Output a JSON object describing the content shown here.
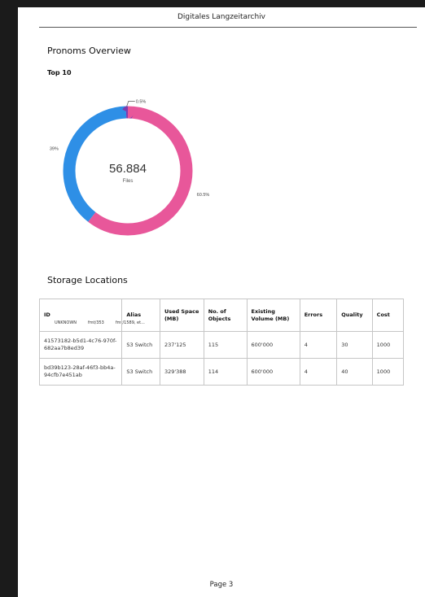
{
  "header": {
    "title": "Digitales Langzeitarchiv"
  },
  "pronoms": {
    "title": "Pronoms Overview",
    "subtitle": "Top 10"
  },
  "chart_data": {
    "type": "pie",
    "variant": "donut",
    "title": "Top 10",
    "center_value": "56.884",
    "center_label": "Files",
    "categories": [
      "UNKNOWN",
      "fmt/353",
      "fmt/1589, et..."
    ],
    "values": [
      39,
      60.5,
      0.5
    ],
    "slice_labels": [
      "39%",
      "60.5%",
      "0.5%"
    ],
    "colors": [
      "#2e8fe6",
      "#e8579a",
      "#7b3db0"
    ],
    "legend_position": "bottom-left"
  },
  "storage": {
    "title": "Storage Locations",
    "columns": [
      "ID",
      "Alias",
      "Used Space (MB)",
      "No. of Objects",
      "Existing Volume (MB)",
      "Errors",
      "Quality",
      "Cost"
    ],
    "rows": [
      [
        "41573182-b5d1-4c76-970f-682aa7b8ed39",
        "S3 Switch",
        "237'125",
        "115",
        "600'000",
        "4",
        "30",
        "1000"
      ],
      [
        "bd39b123-28af-46f3-bb4a-94cfb7e451ab",
        "S3 Switch",
        "329'388",
        "114",
        "600'000",
        "4",
        "40",
        "1000"
      ]
    ]
  },
  "footer": {
    "page_label": "Page 3"
  }
}
